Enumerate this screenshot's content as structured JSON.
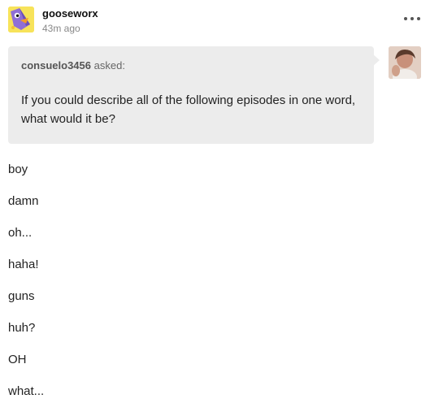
{
  "post": {
    "author": "gooseworx",
    "timestamp": "43m ago",
    "more_icon": "more-horizontal-icon"
  },
  "ask": {
    "asker": "consuelo3456",
    "asked_label": "asked:",
    "question": "If you could describe all of the following episodes in one word, what would it be?"
  },
  "answers": [
    "boy",
    "damn",
    "oh...",
    "haha!",
    "guns",
    "huh?",
    "OH",
    "what..."
  ],
  "colors": {
    "ask_background": "#ececec",
    "text": "#222222",
    "muted": "#888888",
    "avatar_yellow": "#f7e35a",
    "avatar_purple": "#8f6fd6"
  }
}
